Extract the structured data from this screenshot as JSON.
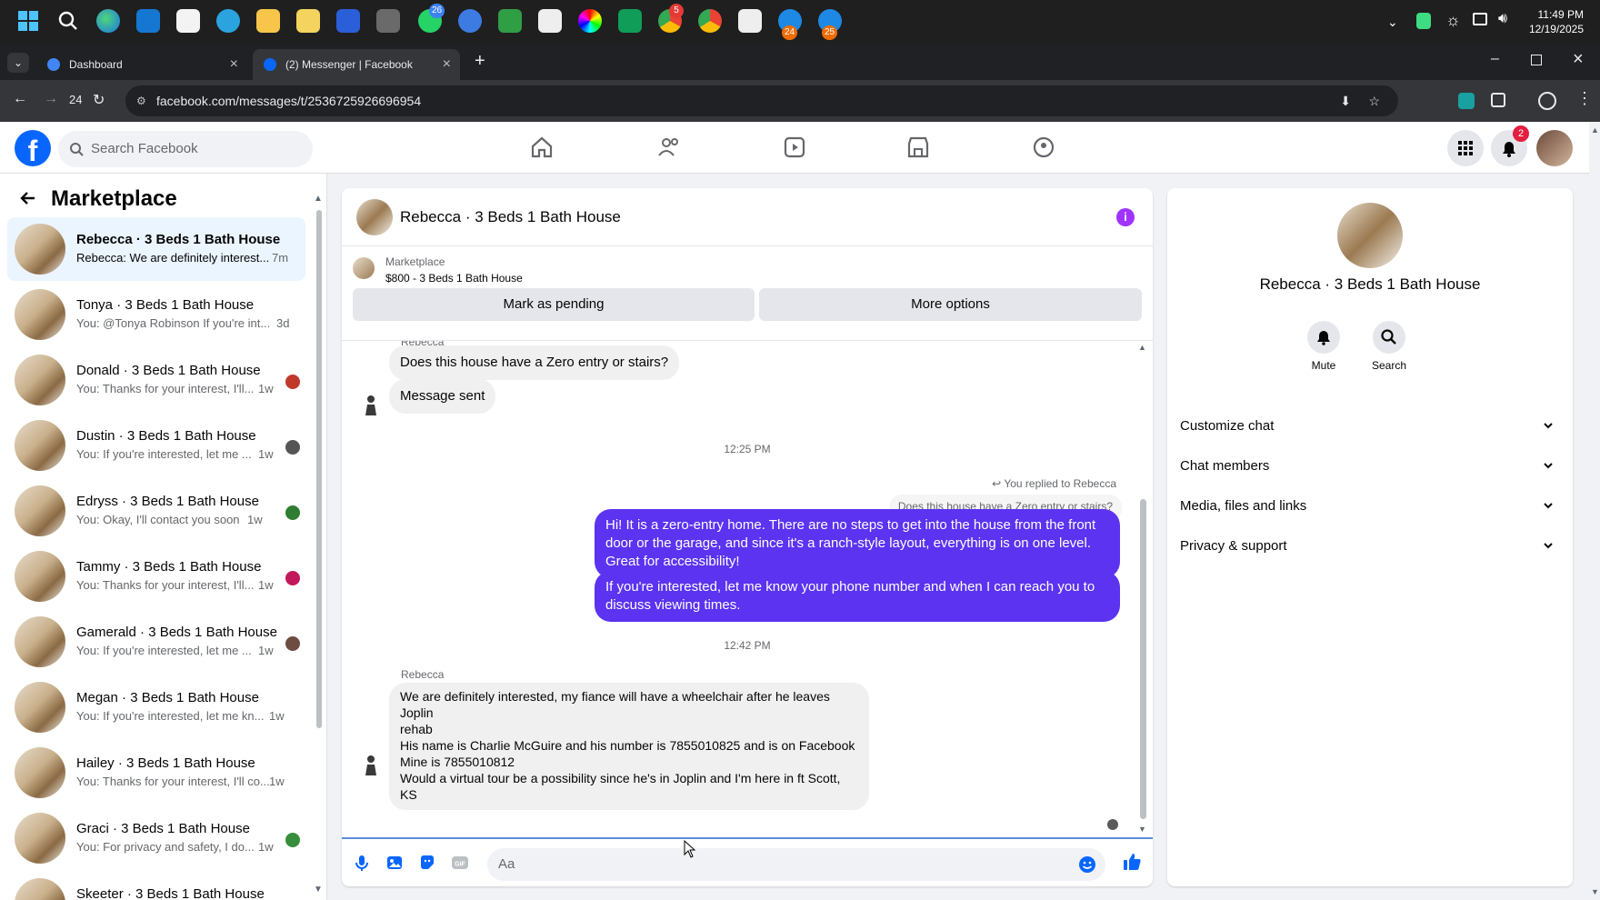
{
  "taskbar": {
    "badges": [
      "26",
      "5",
      "24",
      "25"
    ],
    "time": "11:49 PM",
    "date": "12/19/2025"
  },
  "browser": {
    "tabs": [
      {
        "label": "Dashboard"
      },
      {
        "label": "(2) Messenger | Facebook"
      }
    ],
    "url": "facebook.com/messages/t/2536725926696954",
    "badge_24": "24"
  },
  "fb": {
    "search_placeholder": "Search Facebook",
    "notif_count": "2"
  },
  "sidebar": {
    "title": "Marketplace",
    "conversations": [
      {
        "name": "Rebecca · 3 Beds 1 Bath House",
        "preview": "Rebecca: We are definitely interest...",
        "time": "7m"
      },
      {
        "name": "Tonya · 3 Beds 1 Bath House",
        "preview": "You: @Tonya Robinson If you're int...",
        "time": "3d"
      },
      {
        "name": "Donald · 3 Beds 1 Bath House",
        "preview": "You: Thanks for your interest, I'll...",
        "time": "1w"
      },
      {
        "name": "Dustin · 3 Beds 1 Bath House",
        "preview": "You: If you're interested, let me ...",
        "time": "1w"
      },
      {
        "name": "Edryss · 3 Beds 1 Bath House",
        "preview": "You: Okay, I'll contact you soon",
        "time": "1w"
      },
      {
        "name": "Tammy · 3 Beds 1 Bath House",
        "preview": "You: Thanks for your interest, I'll...",
        "time": "1w"
      },
      {
        "name": "Gamerald · 3 Beds 1 Bath House",
        "preview": "You: If you're interested, let me ...",
        "time": "1w"
      },
      {
        "name": "Megan · 3 Beds 1 Bath House",
        "preview": "You: If you're interested, let me kn...",
        "time": "1w"
      },
      {
        "name": "Hailey · 3 Beds 1 Bath House",
        "preview": "You: Thanks for your interest, I'll co...",
        "time": "1w"
      },
      {
        "name": "Graci · 3 Beds 1 Bath House",
        "preview": "You: For privacy and safety, I do...",
        "time": "1w"
      },
      {
        "name": "Skeeter · 3 Beds 1 Bath House",
        "preview": "",
        "time": ""
      }
    ]
  },
  "chat": {
    "title": "Rebecca · 3 Beds 1 Bath House",
    "listing_category": "Marketplace",
    "listing_desc": "$800 - 3 Beds 1 Bath House",
    "btn_pending": "Mark as pending",
    "btn_more": "More options",
    "sender_top": "Rebecca",
    "msg_stairs": "Does this house have a Zero entry or stairs?",
    "msg_sent": "Message sent",
    "time_1": "12:25 PM",
    "replied_to": "You replied to Rebecca",
    "quoted": "Does this house have a Zero entry or stairs?",
    "out_1_lines": [
      "Hi! It is a zero-entry home. There are no steps to get into the house from the front",
      "door or the garage, and since it's a ranch-style layout, everything is on one level.",
      "Great for accessibility!"
    ],
    "out_2_lines": [
      "If you're interested, let me know your phone number and when I can reach you to",
      "discuss viewing times."
    ],
    "time_2": "12:42 PM",
    "sender_bottom": "Rebecca",
    "in_long_lines": [
      "We are definitely interested, my fiance will have a wheelchair after he leaves Joplin",
      "rehab",
      "His name is Charlie McGuire and his number is 7855010825 and is on Facebook",
      "Mine is 7855010812",
      "Would a virtual tour be a possibility since he's in Joplin and I'm here in ft Scott, KS"
    ],
    "composer_placeholder": "Aa"
  },
  "details": {
    "name": "Rebecca · 3 Beds 1 Bath House",
    "mute": "Mute",
    "search": "Search",
    "rows": [
      "Customize chat",
      "Chat members",
      "Media, files and links",
      "Privacy & support"
    ]
  },
  "colors": {
    "accent": "#5b33f0",
    "fb_blue": "#0866ff",
    "info": "#a033ff"
  }
}
